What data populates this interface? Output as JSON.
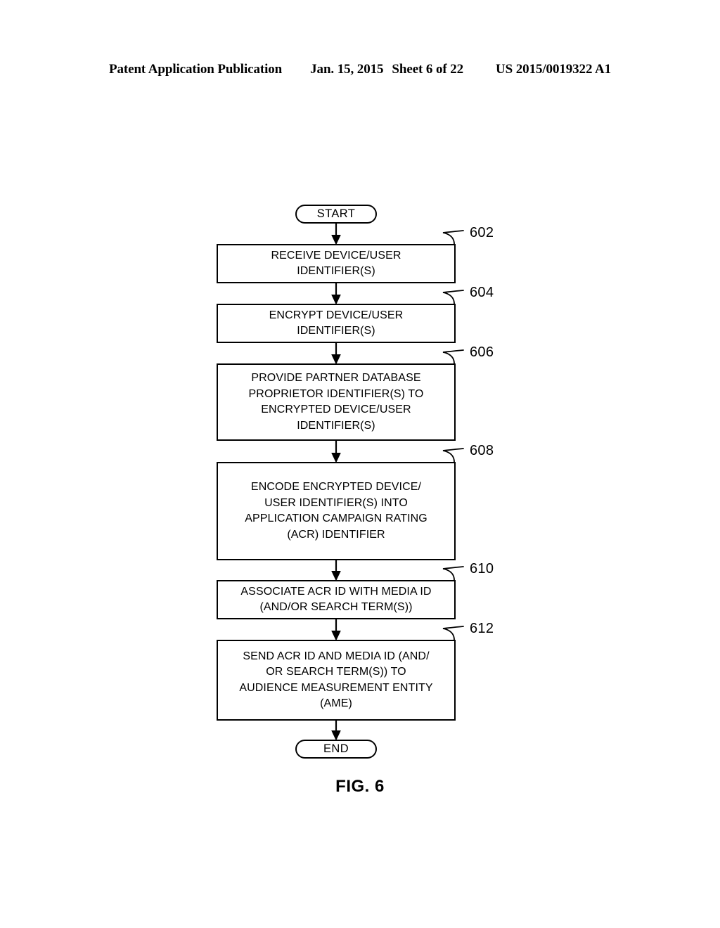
{
  "header": {
    "publication": "Patent Application Publication",
    "date": "Jan. 15, 2015",
    "sheet": "Sheet 6 of 22",
    "patent_number": "US 2015/0019322 A1"
  },
  "figure": {
    "caption": "FIG. 6",
    "type": "flowchart"
  },
  "flowchart": {
    "start_label": "START",
    "end_label": "END",
    "steps": [
      {
        "ref": "602",
        "text": "RECEIVE DEVICE/USER\nIDENTIFIER(S)"
      },
      {
        "ref": "604",
        "text": "ENCRYPT DEVICE/USER\nIDENTIFIER(S)"
      },
      {
        "ref": "606",
        "text": "PROVIDE PARTNER DATABASE\nPROPRIETOR IDENTIFIER(S) TO\nENCRYPTED DEVICE/USER\nIDENTIFIER(S)"
      },
      {
        "ref": "608",
        "text": "ENCODE ENCRYPTED DEVICE/\nUSER IDENTIFIER(S) INTO\nAPPLICATION CAMPAIGN RATING\n(ACR) IDENTIFIER"
      },
      {
        "ref": "610",
        "text": "ASSOCIATE ACR ID WITH MEDIA ID\n(AND/OR SEARCH TERM(S))"
      },
      {
        "ref": "612",
        "text": "SEND ACR ID AND MEDIA ID (AND/\nOR SEARCH TERM(S)) TO\nAUDIENCE MEASUREMENT ENTITY\n(AME)"
      }
    ]
  },
  "colors": {
    "ink": "#000000",
    "paper": "#ffffff"
  }
}
